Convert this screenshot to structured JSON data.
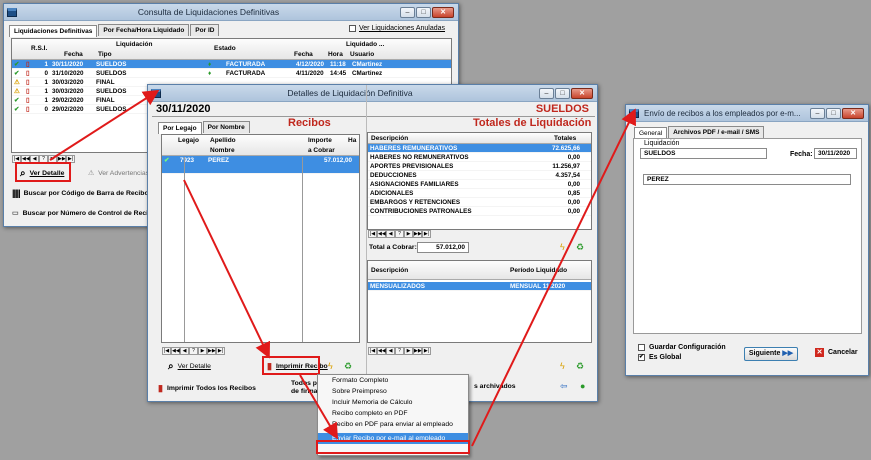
{
  "win1": {
    "title": "Consulta de Liquidaciones Definitivas",
    "tabs": [
      "Liquidaciones Definitivas",
      "Por Fecha/Hora Liquidado",
      "Por ID"
    ],
    "ver_anuladas": "Ver Liquidaciones Anuladas",
    "headers": {
      "rsi": "R.S.I.",
      "liquidacion": "Liquidación",
      "fecha": "Fecha",
      "tipo": "Tipo",
      "estado": "Estado",
      "liquidado": "Liquidado ...",
      "fecha2": "Fecha",
      "hora": "Hora",
      "usuario": "Usuario"
    },
    "rows": [
      {
        "n": "1",
        "fecha": "30/11/2020",
        "tipo": "SUELDOS",
        "estado": "FACTURADA",
        "f2": "4/12/2020",
        "hora": "11:18",
        "usuario": "CMartinez",
        "sel": true
      },
      {
        "n": "0",
        "fecha": "31/10/2020",
        "tipo": "SUELDOS",
        "estado": "FACTURADA",
        "f2": "4/11/2020",
        "hora": "14:45",
        "usuario": "CMartinez"
      },
      {
        "n": "1",
        "fecha": "30/03/2020",
        "tipo": "FINAL",
        "estado": "",
        "f2": "",
        "hora": "",
        "usuario": ""
      },
      {
        "n": "1",
        "fecha": "30/03/2020",
        "tipo": "SUELDOS",
        "estado": "",
        "f2": "",
        "hora": "",
        "usuario": ""
      },
      {
        "n": "1",
        "fecha": "29/02/2020",
        "tipo": "FINAL",
        "estado": "",
        "f2": "",
        "hora": "",
        "usuario": ""
      },
      {
        "n": "0",
        "fecha": "29/02/2020",
        "tipo": "SUELDOS",
        "estado": "",
        "f2": "",
        "hora": "",
        "usuario": ""
      }
    ],
    "ver_detalle": "Ver Detalle",
    "ver_advertencias": "Ver Advertencias",
    "buscar_codigo": "Buscar por Código de Barra de Recibo",
    "buscar_numero": "Buscar por Número de Control de Recib"
  },
  "win2": {
    "title": "Detalles de Liquidación Definitiva",
    "fecha": "30/11/2020",
    "tipo": "SUELDOS",
    "recibos_title": "Recibos",
    "tabs": [
      "Por Legajo",
      "Por Nombre"
    ],
    "headers": {
      "legajo": "Legajo",
      "apellido": "Apellido",
      "nombre": "Nombre",
      "importe": "Importe",
      "a_cobrar": "a Cobrar",
      "ha": "Ha"
    },
    "recibo_row": {
      "legajo": "7923",
      "apellido": "PEREZ",
      "importe": "57.012,00"
    },
    "totales_title": "Totales de Liquidación",
    "totales_headers": {
      "descripcion": "Descripción",
      "totales": "Totales"
    },
    "totales": [
      {
        "d": "HABERES REMUNERATIVOS",
        "v": "72.625,66",
        "sel": true
      },
      {
        "d": "HABERES NO REMUNERATIVOS",
        "v": "0,00"
      },
      {
        "d": "APORTES PREVISIONALES",
        "v": "11.256,97"
      },
      {
        "d": "DEDUCCIONES",
        "v": "4.357,54"
      },
      {
        "d": "ASIGNACIONES FAMILIARES",
        "v": "0,00"
      },
      {
        "d": "ADICIONALES",
        "v": "0,85"
      },
      {
        "d": "EMBARGOS Y RETENCIONES",
        "v": "0,00"
      },
      {
        "d": "CONTRIBUCIONES PATRONALES",
        "v": "0,00"
      }
    ],
    "total_label": "Total a Cobrar:",
    "total_value": "57.012,00",
    "periodo_headers": {
      "descripcion": "Descripción",
      "periodo": "Período Liquidado"
    },
    "periodo_row": {
      "d": "MENSUALIZADOS",
      "p": "MENSUAL 11/2020"
    },
    "ver_detalle": "Ver Detalle",
    "imprimir_recibo": "Imprimir Recibo",
    "imprimir_todos": "Imprimir Todos los Recibos",
    "todos_pe": "Todos pe",
    "de_firma": "de firma",
    "archivados": "s archivados"
  },
  "menu": [
    "Formato Completo",
    "Sobre Preimpreso",
    "Incluir Memoria de Cálculo",
    "Recibo completo en PDF",
    "Recibo en PDF para enviar al empleado",
    "Enviar Recibo por e-mail al empleado"
  ],
  "win3": {
    "title": "Envío de recibos a los empleados por e-m...",
    "tabs": [
      "General",
      "Archivos PDF / e-mail / SMS"
    ],
    "liquidacion_label": "Liquidación",
    "liquidacion_value": "SUELDOS",
    "fecha_label": "Fecha:",
    "fecha_value": "30/11/2020",
    "empleado": "PEREZ",
    "guardar": "Guardar Configuración",
    "es_global": "Es Global",
    "siguiente": "Siguiente",
    "cancelar": "Cancelar"
  }
}
